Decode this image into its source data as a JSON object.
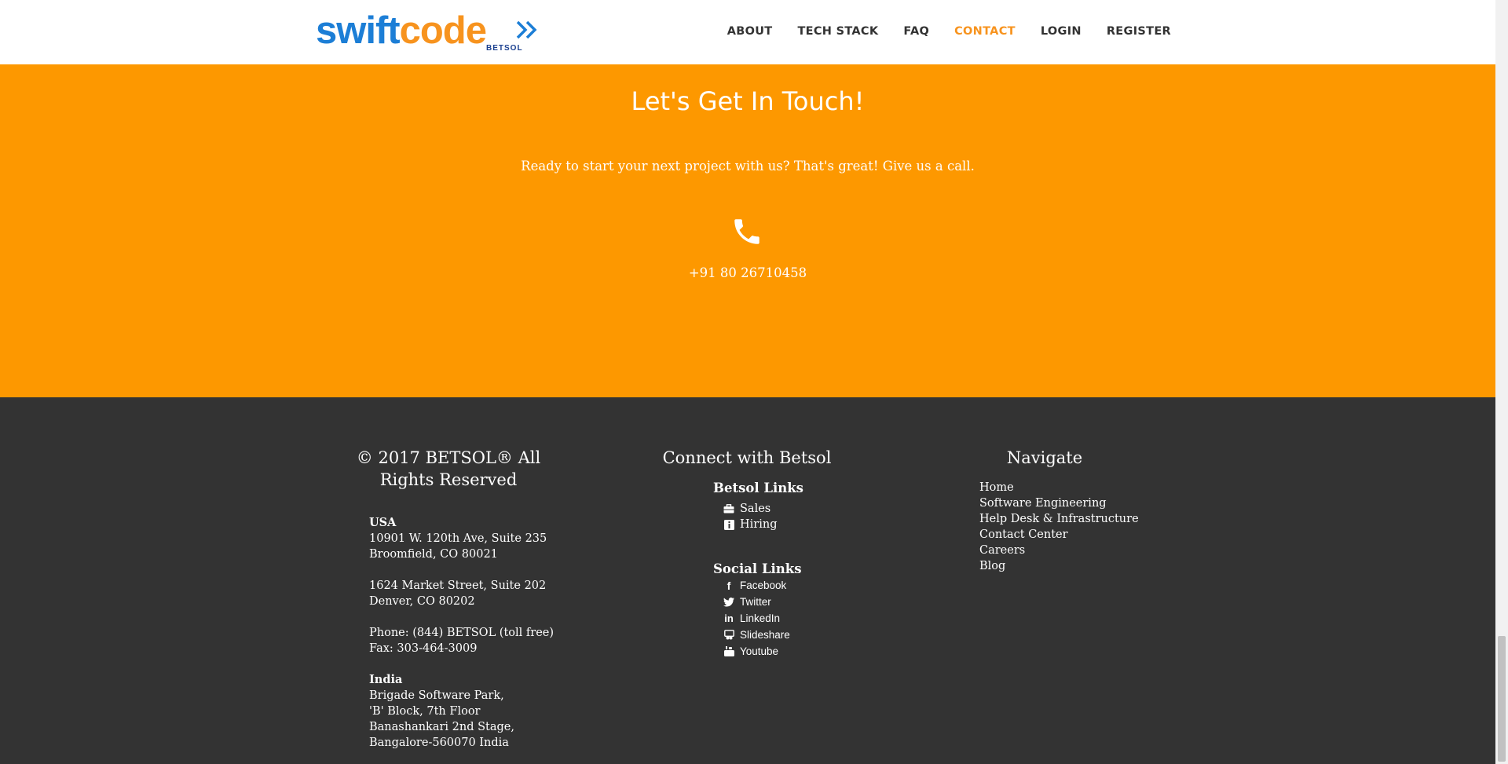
{
  "header": {
    "logo": {
      "part1": "swift",
      "part2": "code",
      "sub": "BETSOL"
    },
    "nav": [
      {
        "label": "ABOUT",
        "active": false
      },
      {
        "label": "TECH STACK",
        "active": false
      },
      {
        "label": "FAQ",
        "active": false
      },
      {
        "label": "CONTACT",
        "active": true
      },
      {
        "label": "LOGIN",
        "active": false
      },
      {
        "label": "REGISTER",
        "active": false
      }
    ]
  },
  "contact": {
    "title": "Let's Get In Touch!",
    "text": "Ready to start your next project with us? That's great! Give us a call.",
    "phone_icon": "phone-icon",
    "phone": "+91 80 26710458"
  },
  "footer": {
    "copyright": "© 2017 BETSOL® All Rights Reserved",
    "address": {
      "usa_label": "USA",
      "usa_1_line1": "10901 W. 120th Ave, Suite 235",
      "usa_1_line2": "Broomfield, CO 80021",
      "usa_2_line1": "1624 Market Street, Suite 202",
      "usa_2_line2": "Denver, CO 80202",
      "phone": "Phone: (844) BETSOL (toll free)",
      "fax": "Fax: 303-464-3009",
      "india_label": "India",
      "india_line1": "Brigade Software Park,",
      "india_line2": "'B' Block, 7th Floor",
      "india_line3": "Banashankari 2nd Stage,",
      "india_line4": "Bangalore-560070 India"
    },
    "connect_title": "Connect with Betsol",
    "betsol_links_title": "Betsol Links",
    "betsol_links": [
      {
        "label": "Sales",
        "icon": "briefcase-icon"
      },
      {
        "label": "Hiring",
        "icon": "info-icon"
      }
    ],
    "social_title": "Social Links",
    "social_links": [
      {
        "label": "Facebook",
        "icon": "facebook-icon"
      },
      {
        "label": "Twitter",
        "icon": "twitter-icon"
      },
      {
        "label": "LinkedIn",
        "icon": "linkedin-icon"
      },
      {
        "label": "Slideshare",
        "icon": "slideshare-icon"
      },
      {
        "label": "Youtube",
        "icon": "youtube-icon"
      }
    ],
    "navigate_title": "Navigate",
    "navigate": [
      "Home",
      "Software Engineering",
      "Help Desk & Infrastructure",
      "Contact Center",
      "Careers",
      "Blog"
    ]
  },
  "colors": {
    "orange": "#fd9800",
    "accent": "#f7931e",
    "blue": "#1c7ed6",
    "footer_bg": "#333333"
  }
}
